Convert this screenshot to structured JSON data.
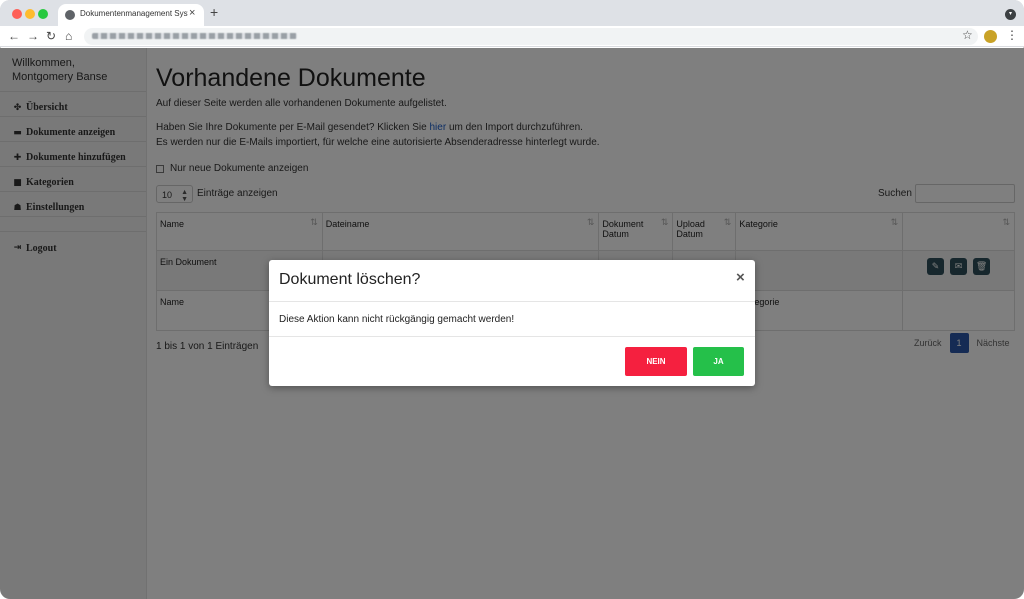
{
  "browser": {
    "tab_title": "Dokumentenmanagement Syst",
    "close_glyph": "×",
    "new_tab_glyph": "+",
    "back_glyph": "←",
    "forward_glyph": "→",
    "reload_glyph": "↻",
    "home_glyph": "⌂",
    "star_glyph": "☆",
    "menu_glyph": "⋮",
    "tab_menu_glyph": "▾"
  },
  "sidebar": {
    "welcome_line1": "Willkommen,",
    "welcome_line2": "Montgomery Banse",
    "items": [
      {
        "label": "Übersicht",
        "icon": "paw-icon",
        "glyph": "✤"
      },
      {
        "label": "Dokumente anzeigen",
        "icon": "inbox-icon",
        "glyph": "▬"
      },
      {
        "label": "Dokumente hinzufügen",
        "icon": "plus-icon",
        "glyph": "✚"
      },
      {
        "label": "Kategorien",
        "icon": "folder-icon",
        "glyph": "■"
      },
      {
        "label": "Einstellungen",
        "icon": "user-cog-icon",
        "glyph": "☗"
      }
    ],
    "logout": {
      "label": "Logout",
      "icon": "logout-icon",
      "glyph": "⇥"
    }
  },
  "main": {
    "title": "Vorhandene Dokumente",
    "intro": "Auf dieser Seite werden alle vorhandenen Dokumente aufgelistet.",
    "email_pre": "Haben Sie Ihre Dokumente per E-Mail gesendet? Klicken Sie ",
    "email_link": "hier",
    "email_post": " um den Import durchzuführen.",
    "email_note": "Es werden nur die E-Mails importiert, für welche eine autorisierte Absenderadresse hinterlegt wurde.",
    "only_new_label": "Nur neue Dokumente anzeigen",
    "length_value": "10",
    "length_label": "Einträge anzeigen",
    "search_label": "Suchen",
    "table": {
      "headers": [
        "Name",
        "Dateiname",
        "Dokument Datum",
        "Upload Datum",
        "Kategorie",
        ""
      ],
      "sort_glyph": "⇅",
      "row": {
        "name": "Ein Dokument"
      },
      "footers": [
        "Name",
        "",
        "",
        "",
        "egorie",
        ""
      ]
    },
    "info": "1 bis 1 von 1 Einträgen",
    "pager": {
      "prev": "Zurück",
      "current": "1",
      "next": "Nächste"
    }
  },
  "modal": {
    "title": "Dokument löschen?",
    "close_glyph": "×",
    "text": "Diese Aktion kann nicht rückgängig gemacht werden!",
    "no_label": "NEIN",
    "yes_label": "JA",
    "no_color": "#f5203f",
    "yes_color": "#25c04a"
  },
  "actions": {
    "edit_glyph": "✎",
    "mail_glyph": "✉",
    "delete_glyph": "🗑"
  }
}
